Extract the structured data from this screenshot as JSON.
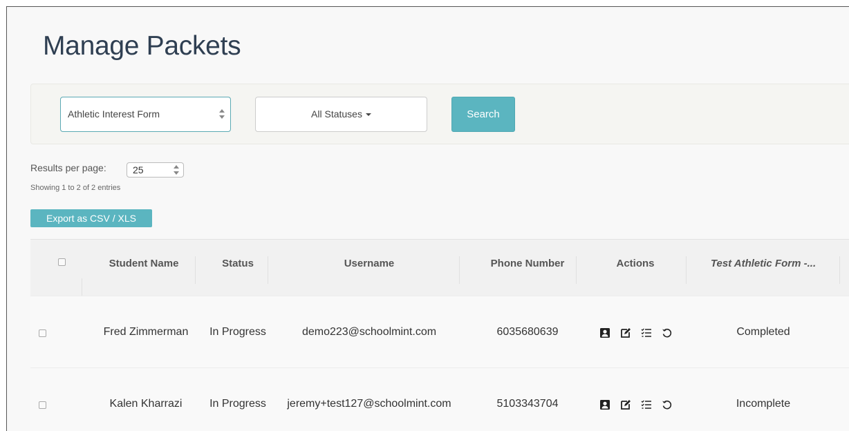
{
  "page": {
    "title": "Manage Packets"
  },
  "filters": {
    "form_select": "Athletic Interest Form",
    "status_dropdown": "All Statuses",
    "search_label": "Search"
  },
  "pagination": {
    "results_per_page_label": "Results per page:",
    "results_per_page_value": "25",
    "showing_text": "Showing 1 to 2 of 2 entries"
  },
  "export_label": "Export as CSV / XLS",
  "table": {
    "headers": [
      "Student Name",
      "Status",
      "Username",
      "Phone Number",
      "Actions",
      "Test Athletic Form -..."
    ],
    "rows": [
      {
        "student_name": "Fred Zimmerman",
        "status": "In Progress",
        "username": "demo223@schoolmint.com",
        "phone": "6035680639",
        "form_status": "Completed"
      },
      {
        "student_name": "Kalen Kharrazi",
        "status": "In Progress",
        "username": "jeremy+test127@schoolmint.com",
        "phone": "5103343704",
        "form_status": "Incomplete"
      }
    ],
    "action_icons": [
      "profile-card-icon",
      "edit-icon",
      "checklist-icon",
      "reset-icon"
    ]
  },
  "colors": {
    "accent": "#5bb5c0",
    "title": "#2f3f52"
  }
}
